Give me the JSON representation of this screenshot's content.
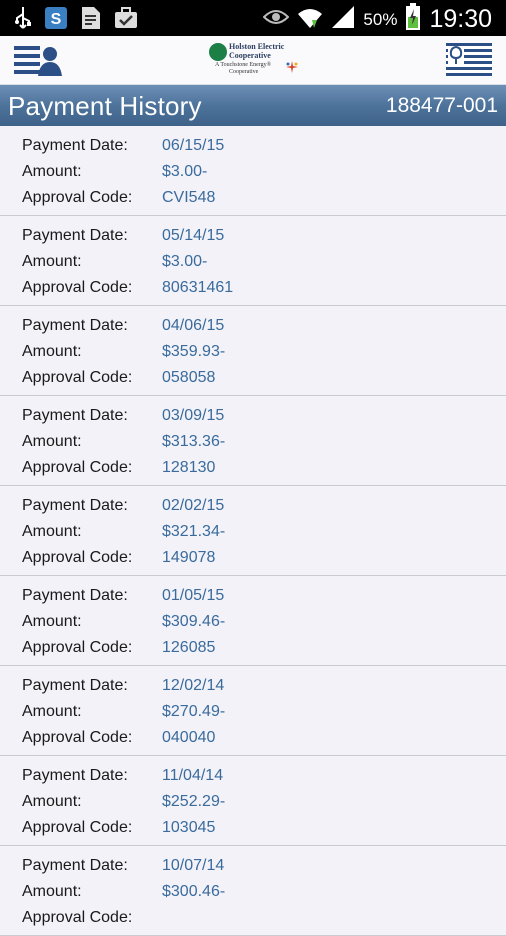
{
  "status_bar": {
    "battery_percent": "50%",
    "time": "19:30",
    "icons": [
      "usb-icon",
      "skype-icon",
      "document-icon",
      "briefcase-icon",
      "eye-icon",
      "wifi-icon",
      "signal-icon",
      "battery-icon"
    ]
  },
  "app_bar": {
    "logo": {
      "line1": "Holston Electric",
      "line2": "Cooperative",
      "tag1": "A Touchstone Energy®",
      "tag2": "Cooperative"
    }
  },
  "header": {
    "title": "Payment History",
    "account_number": "188477-001"
  },
  "labels": {
    "date": "Payment Date:",
    "amount": "Amount:",
    "code": "Approval Code:"
  },
  "payments": [
    {
      "date": "06/15/15",
      "amount": "$3.00-",
      "code": "CVI548"
    },
    {
      "date": "05/14/15",
      "amount": "$3.00-",
      "code": "80631461"
    },
    {
      "date": "04/06/15",
      "amount": "$359.93-",
      "code": "058058"
    },
    {
      "date": "03/09/15",
      "amount": "$313.36-",
      "code": "128130"
    },
    {
      "date": "02/02/15",
      "amount": "$321.34-",
      "code": "149078"
    },
    {
      "date": "01/05/15",
      "amount": "$309.46-",
      "code": "126085"
    },
    {
      "date": "12/02/14",
      "amount": "$270.49-",
      "code": "040040"
    },
    {
      "date": "11/04/14",
      "amount": "$252.29-",
      "code": "103045"
    },
    {
      "date": "10/07/14",
      "amount": "$300.46-",
      "code": ""
    }
  ],
  "colors": {
    "header_bg": "#4e739b",
    "value_text": "#3a6b9c",
    "row_bg": "#f2f2f8",
    "icon_blue": "#2b4f86"
  }
}
